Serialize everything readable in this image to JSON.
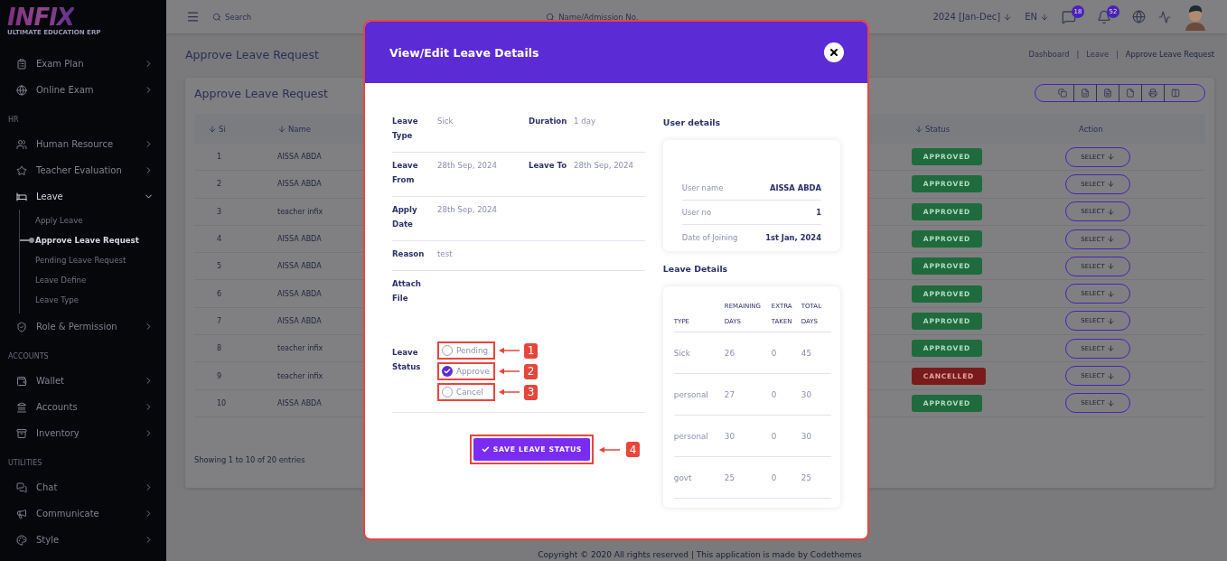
{
  "sidebar": {
    "logo": {
      "text": "INFIX",
      "tagline": "ULTIMATE EDUCATION ERP"
    },
    "groups": [
      {
        "items": [
          {
            "label": "Exam Plan",
            "expanded": false
          },
          {
            "label": "Online Exam",
            "expanded": false
          }
        ]
      },
      {
        "heading": "HR",
        "items": [
          {
            "label": "Human Resource",
            "expanded": false
          },
          {
            "label": "Teacher Evaluation",
            "expanded": false
          },
          {
            "label": "Leave",
            "expanded": true,
            "children": [
              {
                "label": "Apply Leave",
                "selected": false
              },
              {
                "label": "Approve Leave Request",
                "selected": true
              },
              {
                "label": "Pending Leave Request",
                "selected": false
              },
              {
                "label": "Leave Define",
                "selected": false
              },
              {
                "label": "Leave Type",
                "selected": false
              }
            ]
          },
          {
            "label": "Role & Permission",
            "expanded": false
          }
        ]
      },
      {
        "heading": "ACCOUNTS",
        "items": [
          {
            "label": "Wallet",
            "expanded": false
          },
          {
            "label": "Accounts",
            "expanded": false
          },
          {
            "label": "Inventory",
            "expanded": false
          }
        ]
      },
      {
        "heading": "UTILITIES",
        "items": [
          {
            "label": "Chat",
            "expanded": false
          },
          {
            "label": "Communicate",
            "expanded": false
          },
          {
            "label": "Style",
            "expanded": false
          }
        ]
      }
    ]
  },
  "topbar": {
    "search": {
      "placeholder": "Search"
    },
    "student_search": {
      "placeholder": "Name/Admission No."
    },
    "session": "2024 [Jan-Dec]",
    "language": "EN",
    "message_count": "18",
    "notification_count": "52"
  },
  "page": {
    "title": "Approve Leave Request",
    "breadcrumb": [
      "Dashboard",
      "Leave",
      "Approve Leave Request"
    ],
    "breadcrumb_separator": "|",
    "card": {
      "title": "Approve Leave Request",
      "columns": [
        {
          "label": "Si"
        },
        {
          "label": "Name"
        },
        {
          "label": "Status"
        },
        {
          "label": "Action"
        }
      ],
      "rows": [
        {
          "si": "1",
          "name": "AISSA ABDA",
          "status": {
            "label": "APPROVED",
            "kind": "approved"
          },
          "action": "SELECT"
        },
        {
          "si": "2",
          "name": "AISSA ABDA",
          "status": {
            "label": "APPROVED",
            "kind": "approved"
          },
          "action": "SELECT"
        },
        {
          "si": "3",
          "name": "teacher infix",
          "status": {
            "label": "APPROVED",
            "kind": "approved"
          },
          "action": "SELECT"
        },
        {
          "si": "4",
          "name": "AISSA ABDA",
          "status": {
            "label": "APPROVED",
            "kind": "approved"
          },
          "action": "SELECT"
        },
        {
          "si": "5",
          "name": "AISSA ABDA",
          "status": {
            "label": "APPROVED",
            "kind": "approved"
          },
          "action": "SELECT"
        },
        {
          "si": "6",
          "name": "AISSA ABDA",
          "status": {
            "label": "APPROVED",
            "kind": "approved"
          },
          "action": "SELECT"
        },
        {
          "si": "7",
          "name": "AISSA ABDA",
          "status": {
            "label": "APPROVED",
            "kind": "approved"
          },
          "action": "SELECT"
        },
        {
          "si": "8",
          "name": "teacher infix",
          "status": {
            "label": "APPROVED",
            "kind": "approved"
          },
          "action": "SELECT"
        },
        {
          "si": "9",
          "name": "teacher infix",
          "status": {
            "label": "CANCELLED",
            "kind": "cancelled"
          },
          "action": "SELECT"
        },
        {
          "si": "10",
          "name": "AISSA ABDA",
          "status": {
            "label": "APPROVED",
            "kind": "approved"
          },
          "action": "SELECT"
        }
      ],
      "info": "Showing 1 to 10 of 20 entries"
    },
    "copyright": "Copyright © 2020 All rights reserved | This application is made by Codethemes"
  },
  "modal": {
    "title": "View/Edit Leave Details",
    "details": [
      {
        "cells": [
          {
            "label": "Leave Type",
            "value": "Sick"
          },
          {
            "label": "Duration",
            "value": "1 day"
          }
        ]
      },
      {
        "cells": [
          {
            "label": "Leave From",
            "value": "28th Sep, 2024"
          },
          {
            "label": "Leave To",
            "value": "28th Sep, 2024"
          }
        ]
      },
      {
        "cells": [
          {
            "label": "Apply Date",
            "value": "28th Sep, 2024"
          }
        ]
      },
      {
        "cells": [
          {
            "label": "Reason",
            "value": "test"
          }
        ]
      },
      {
        "cells": [
          {
            "label": "Attach File"
          }
        ]
      }
    ],
    "leave_status": {
      "label": "Leave Status",
      "options": [
        {
          "label": "Pending",
          "selected": false,
          "annotation": "1"
        },
        {
          "label": "Approve",
          "selected": true,
          "annotation": "2"
        },
        {
          "label": "Cancel",
          "selected": false,
          "annotation": "3"
        }
      ]
    },
    "save_button": {
      "label": "SAVE LEAVE STATUS",
      "annotation": "4"
    },
    "user_details": {
      "title": "User details",
      "rows": [
        {
          "label": "User name",
          "value": "AISSA ABDA"
        },
        {
          "label": "User no",
          "value": "1"
        },
        {
          "label": "Date of Joining",
          "value": "1st Jan, 2024"
        }
      ]
    },
    "leave_details": {
      "title": "Leave Details",
      "columns": [
        "TYPE",
        "REMAINING DAYS",
        "EXTRA TAKEN",
        "TOTAL DAYS"
      ],
      "rows": [
        [
          "Sick",
          "26",
          "0",
          "45"
        ],
        [
          "personal",
          "27",
          "0",
          "30"
        ],
        [
          "personal",
          "30",
          "0",
          "30"
        ],
        [
          "govt",
          "25",
          "0",
          "25"
        ]
      ]
    }
  }
}
